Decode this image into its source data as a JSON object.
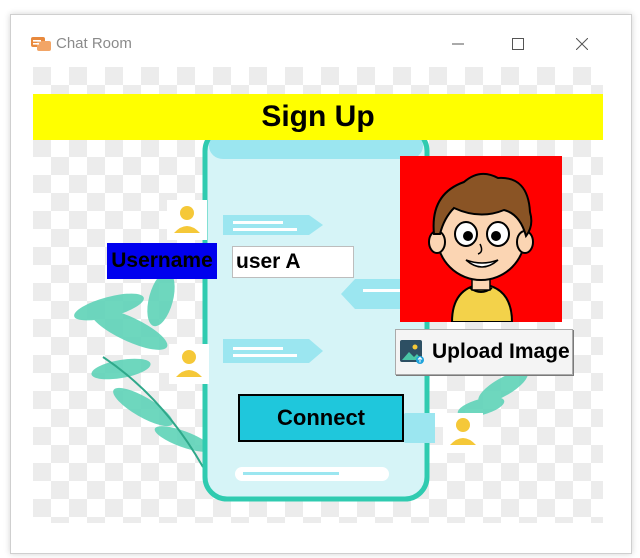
{
  "window": {
    "title": "Chat Room",
    "icon": "chat-icon",
    "controls": [
      "minimize-icon",
      "maximize-icon",
      "close-icon"
    ]
  },
  "header": {
    "title": "Sign Up",
    "bg_color": "#ffff00"
  },
  "form": {
    "username_label": "Username",
    "username_label_bg": "#0000ee",
    "username_value": "user A",
    "upload_button_label": "Upload Image",
    "connect_button_label": "Connect",
    "connect_button_bg": "#1fc7dc"
  },
  "avatar": {
    "bg_color": "#ff0000",
    "icon": "cartoon-boy-avatar"
  },
  "background": {
    "illustration": "phone-chat-illustration"
  }
}
